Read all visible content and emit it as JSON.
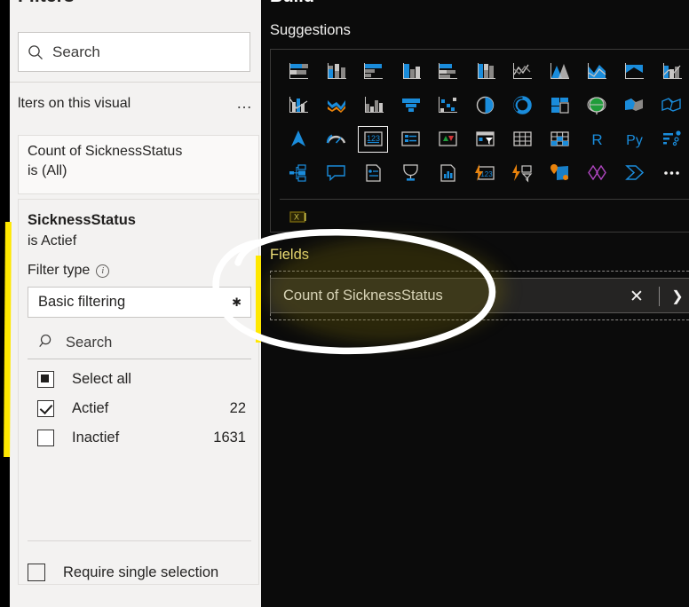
{
  "filters_pane": {
    "title": "Filters",
    "pin_icon": "pin-icon",
    "caret_icon": "chevron-down-icon",
    "expand_icon": "chevron-double-right-icon",
    "search": {
      "placeholder": "Search",
      "icon": "search-icon"
    },
    "section_label": "lters on this visual",
    "section_more": "…",
    "collapsed_card": {
      "line1": "Count of SicknessStatus",
      "line2": "is (All)"
    },
    "expanded_card": {
      "title": "SicknessStatus",
      "subtitle": "is Actief",
      "filter_type_label": "Filter type",
      "info_icon": "info-icon",
      "filter_type_value": "Basic filtering",
      "dropdown_icon": "chevron-down-icon",
      "search": {
        "placeholder": "Search",
        "icon": "search-icon"
      },
      "values": [
        {
          "label": "Select all",
          "count": "",
          "state": "partial"
        },
        {
          "label": "Actief",
          "count": "22",
          "state": "checked"
        },
        {
          "label": "Inactief",
          "count": "1631",
          "state": "unchecked"
        }
      ],
      "require_single_selection": {
        "label": "Require single selection",
        "state": "unchecked"
      }
    }
  },
  "build_pane": {
    "title": "Build",
    "more_icon": "ellipsis-icon",
    "suggestions_label": "Suggestions",
    "suggestion_rows": [
      [
        "stacked-bar-chart-icon",
        "stacked-column-chart-icon",
        "clustered-bar-chart-icon",
        "clustered-column-chart-icon",
        "100-stacked-bar-chart-icon",
        "100-stacked-column-chart-icon",
        "line-chart-icon",
        "area-chart-icon",
        "stacked-area-chart-icon",
        "ribbon-chart-icon",
        "line-and-stacked-column-chart-icon"
      ],
      [
        "line-and-clustered-column-chart-icon",
        "waterfall-chart-icon",
        "combo-chart-icon",
        "funnel-chart-icon",
        "scatter-chart-icon",
        "pie-chart-icon",
        "donut-chart-icon",
        "treemap-icon",
        "map-icon",
        "filled-map-icon",
        "shape-map-icon"
      ],
      [
        "azure-map-icon",
        "gauge-chart-icon",
        "card-icon",
        "multi-row-card-icon",
        "kpi-icon",
        "slicer-icon",
        "table-icon",
        "matrix-icon",
        "r-script-visual-icon",
        "python-visual-icon",
        "key-influencers-icon"
      ],
      [
        "decomposition-tree-icon",
        "qa-visual-icon",
        "smart-narrative-icon",
        "paginated-report-icon",
        "metrics-icon",
        "power-apps-icon",
        "power-automate-icon",
        "arcgis-map-icon",
        "visio-visual-icon",
        "power-bi-report-icon",
        "more-visuals-icon"
      ],
      [
        "excel-visual-icon"
      ]
    ],
    "selected_suggestion": "card-icon",
    "fields_label": "Fields",
    "field_items": [
      {
        "name": "Count of SicknessStatus",
        "remove_icon": "close-icon",
        "expand_icon": "chevron-right-icon"
      }
    ]
  },
  "annotations": {
    "circle_color": "#ffffff",
    "highlight_color": "#ffe800",
    "circle_target": "Count of SicknessStatus",
    "left_marker": "yellow-vertical-line",
    "right_marker": "yellow-vertical-line"
  }
}
